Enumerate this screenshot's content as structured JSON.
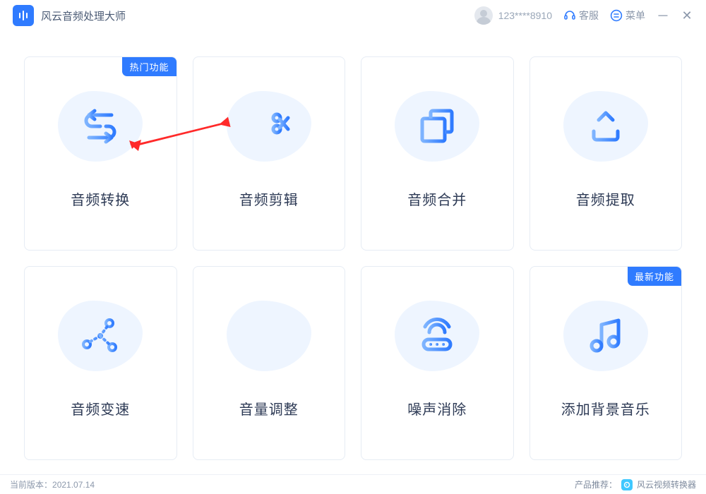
{
  "titlebar": {
    "title": "风云音频处理大师",
    "user_id": "123****8910",
    "support_label": "客服",
    "menu_label": "菜单"
  },
  "cards": [
    {
      "label": "音频转换",
      "badge": "热门功能"
    },
    {
      "label": "音频剪辑",
      "badge": null
    },
    {
      "label": "音频合并",
      "badge": null
    },
    {
      "label": "音频提取",
      "badge": null
    },
    {
      "label": "音频变速",
      "badge": null
    },
    {
      "label": "音量调整",
      "badge": null
    },
    {
      "label": "噪声消除",
      "badge": null
    },
    {
      "label": "添加背景音乐",
      "badge": "最新功能"
    }
  ],
  "statusbar": {
    "version_prefix": "当前版本：",
    "version": "2021.07.14",
    "recommend_prefix": "产品推荐：",
    "recommend_name": "风云视频转换器"
  }
}
